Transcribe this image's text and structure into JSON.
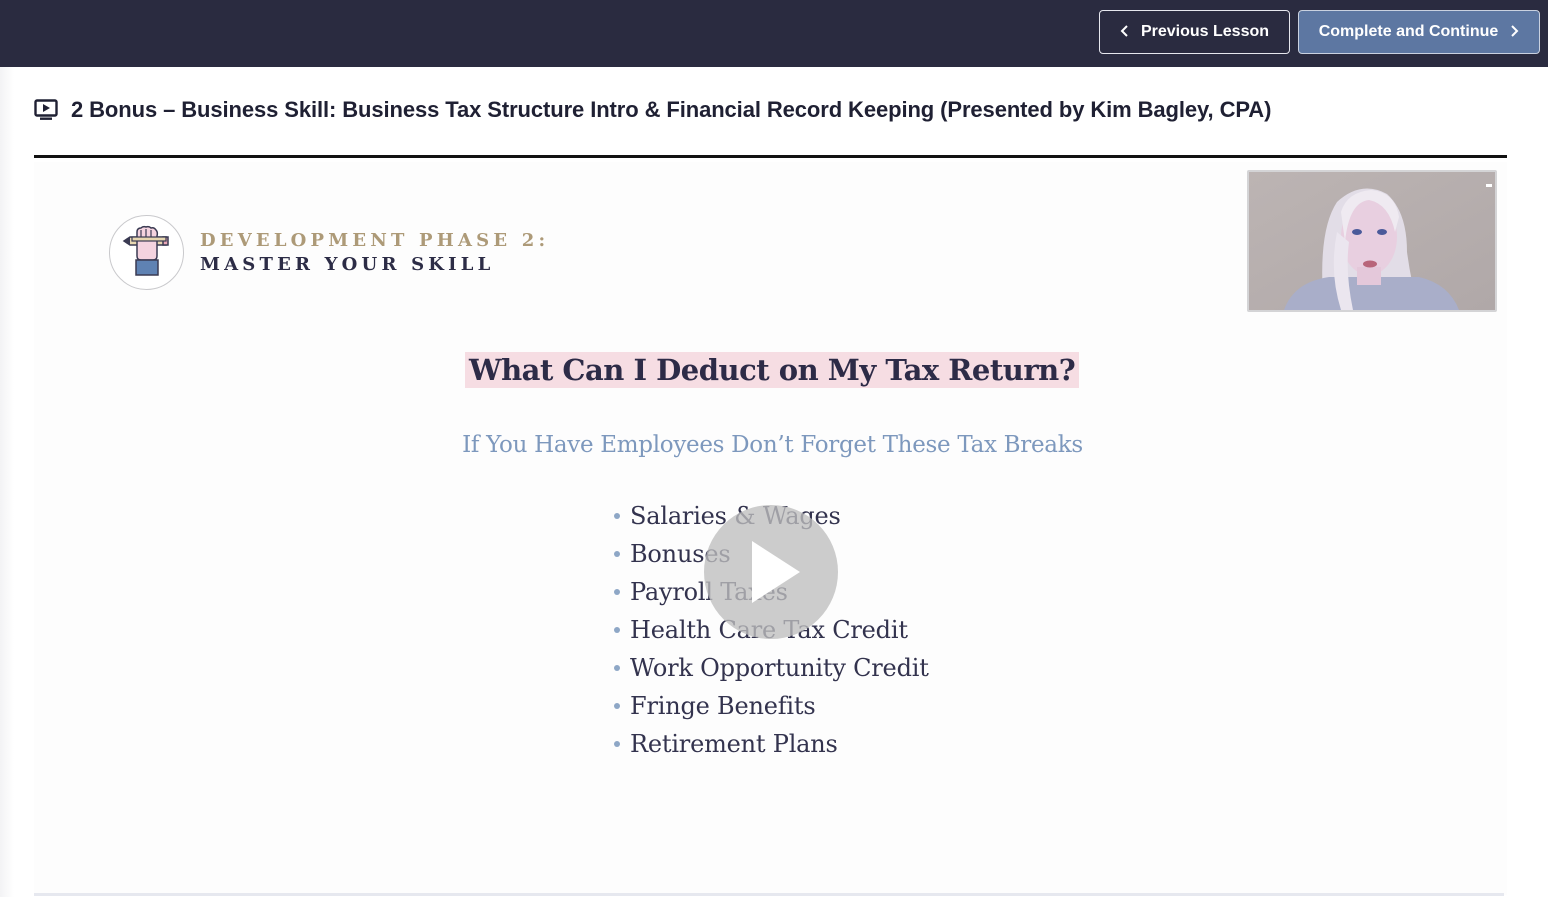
{
  "topbar": {
    "previous_label": "Previous Lesson",
    "complete_label": "Complete and Continue",
    "colors": {
      "bar_background": "#2a2b40",
      "complete_button": "#5d77a2"
    }
  },
  "lesson": {
    "icon": "video-lesson-icon",
    "title": "2 Bonus – Business Skill: Business Tax Structure Intro & Financial Record Keeping (Presented by Kim Bagley, CPA)"
  },
  "video": {
    "state": "paused",
    "play_icon": "play-icon",
    "webcam": {
      "presenter": "Kim Bagley, CPA"
    },
    "slide": {
      "phase_icon": "hand-holding-pencil-icon",
      "phase_line1": "DEVELOPMENT PHASE 2:",
      "phase_line2": "MASTER YOUR SKILL",
      "title": "What Can I Deduct on My Tax Return?",
      "subtitle": "If You Have Employees Don’t Forget These Tax Breaks",
      "items": [
        "Salaries & Wages",
        "Bonuses",
        "Payroll Taxes",
        "Health Care Tax Credit",
        "Work Opportunity Credit",
        "Fringe Benefits",
        "Retirement Plans"
      ],
      "colors": {
        "title_highlight": "#f6dde3",
        "title_text": "#2d2b47",
        "subtitle_text": "#7d98bd",
        "phase_gold": "#ad9a78"
      }
    }
  }
}
